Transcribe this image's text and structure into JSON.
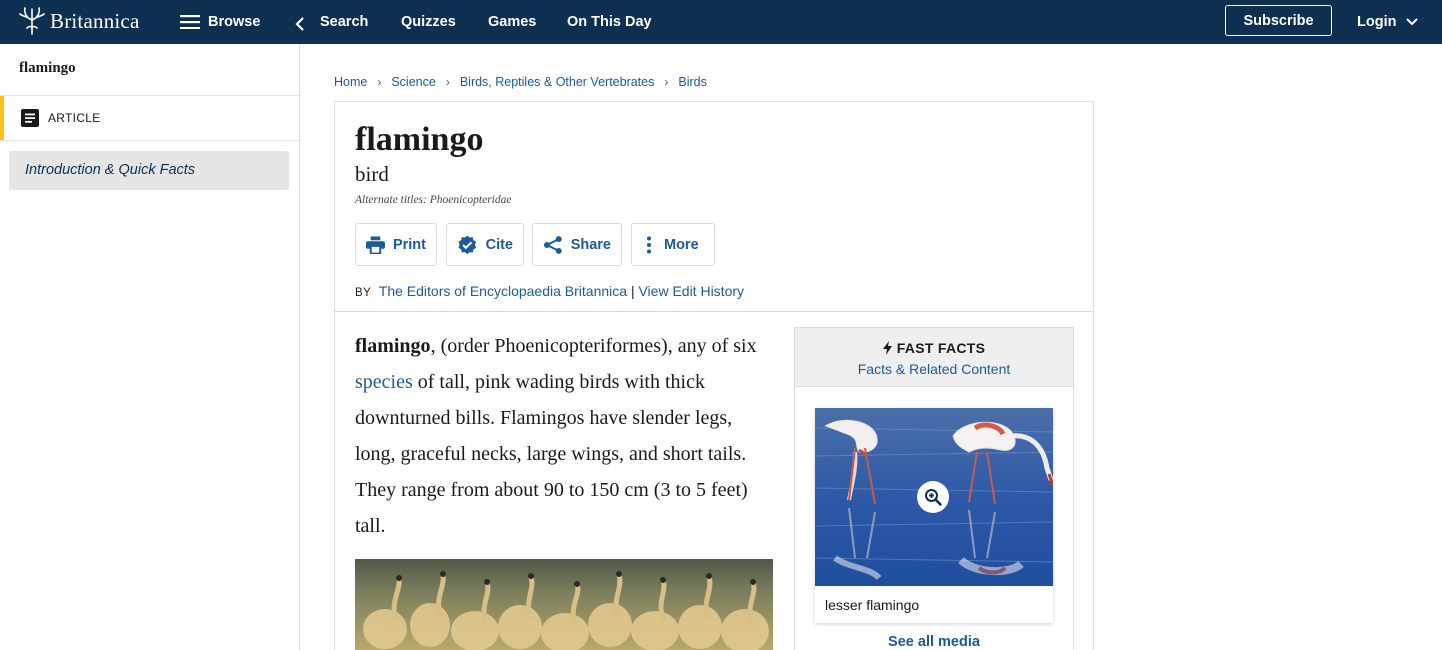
{
  "nav": {
    "logo": "Britannica",
    "browse": "Browse",
    "search": "Search",
    "quizzes": "Quizzes",
    "games": "Games",
    "on_this_day": "On This Day",
    "subscribe": "Subscribe",
    "login": "Login"
  },
  "sidebar": {
    "title": "flamingo",
    "article_label": "ARTICLE",
    "toc": [
      "Introduction & Quick Facts"
    ]
  },
  "breadcrumb": [
    "Home",
    "Science",
    "Birds, Reptiles & Other Vertebrates",
    "Birds"
  ],
  "article": {
    "title": "flamingo",
    "subtitle": "bird",
    "alternate_titles": "Alternate titles: Phoenicopteridae",
    "actions": [
      "Print",
      "Cite",
      "Share",
      "More"
    ],
    "byline_prefix": "BY",
    "author": "The Editors of Encyclopaedia Britannica",
    "byline_sep": "|",
    "edit_history": "View Edit History",
    "intro": {
      "term": "flamingo",
      "part1": ", (order Phoenicopteriformes), any of six ",
      "link": "species",
      "part2": " of tall, pink wading birds with thick downturned bills. Flamingos have slender legs, long, graceful necks, large wings, and short tails. They range from about 90 to 150 cm (3 to 5 feet) tall."
    }
  },
  "fast_facts": {
    "title": "FAST FACTS",
    "subtitle": "Facts & Related Content",
    "media_caption": "lesser flamingo",
    "see_all": "See all media"
  },
  "colors": {
    "navy": "#0d2f52",
    "link": "#1d5a98",
    "accent": "#f7c21a"
  }
}
